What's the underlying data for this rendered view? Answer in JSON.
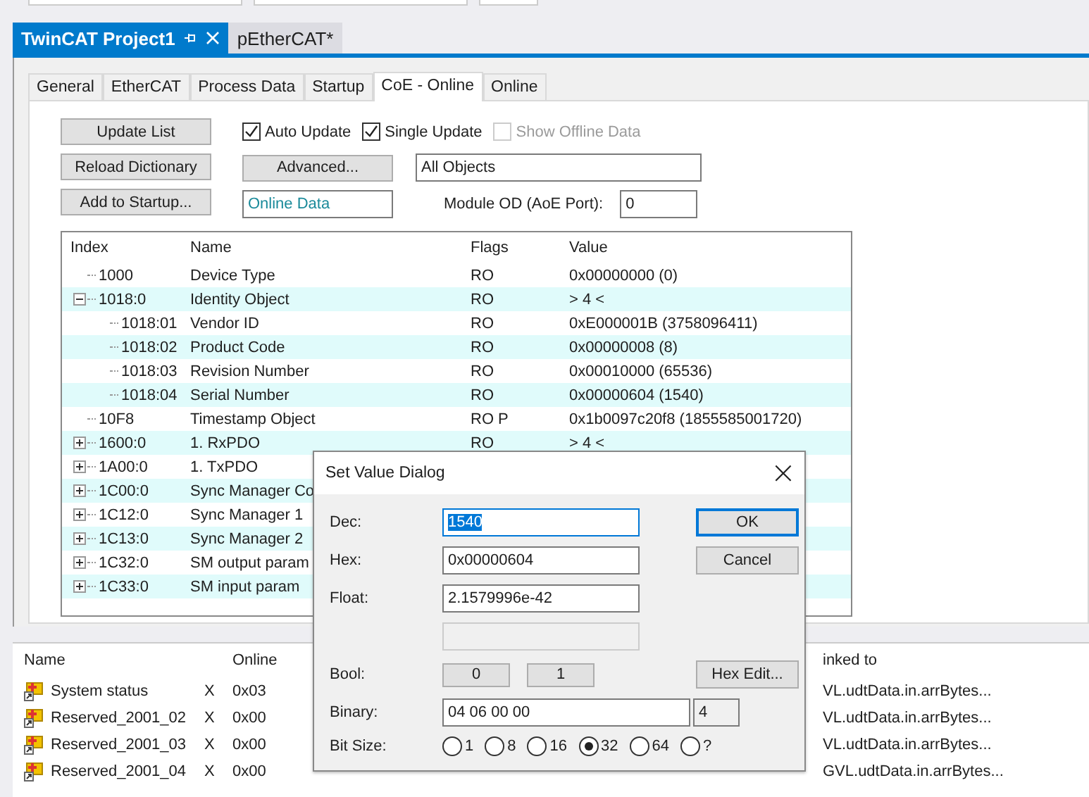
{
  "doc_tabs": [
    {
      "label": "TwinCAT Project1",
      "selected": true
    },
    {
      "label": "pEtherCAT*",
      "selected": false
    }
  ],
  "tabs": [
    {
      "label": "General",
      "selected": false
    },
    {
      "label": "EtherCAT",
      "selected": false
    },
    {
      "label": "Process Data",
      "selected": false
    },
    {
      "label": "Startup",
      "selected": false
    },
    {
      "label": "CoE - Online",
      "selected": true
    },
    {
      "label": "Online",
      "selected": false
    }
  ],
  "buttons": {
    "update_list": "Update List",
    "reload_dictionary": "Reload Dictionary",
    "add_to_startup": "Add to Startup...",
    "advanced": "Advanced..."
  },
  "checkboxes": [
    {
      "label": "Auto Update",
      "checked": true,
      "disabled": false
    },
    {
      "label": "Single Update",
      "checked": true,
      "disabled": false
    },
    {
      "label": "Show Offline Data",
      "checked": false,
      "disabled": true
    }
  ],
  "filter_field": {
    "value": "All Objects"
  },
  "data_field": {
    "value": "Online Data"
  },
  "module_od": {
    "label": "Module OD (AoE Port):",
    "value": "0"
  },
  "tree": {
    "columns": [
      "Index",
      "Name",
      "Flags",
      "Value"
    ],
    "rows": [
      {
        "index": "1000",
        "name": "Device Type",
        "flags": "RO",
        "value": "0x00000000 (0)"
      },
      {
        "index": "1018:0",
        "name": "Identity Object",
        "flags": "RO",
        "value": "> 4 <",
        "expanded": true,
        "children": [
          {
            "index": "1018:01",
            "name": "Vendor ID",
            "flags": "RO",
            "value": "0xE000001B (3758096411)"
          },
          {
            "index": "1018:02",
            "name": "Product Code",
            "flags": "RO",
            "value": "0x00000008 (8)"
          },
          {
            "index": "1018:03",
            "name": "Revision Number",
            "flags": "RO",
            "value": "0x00010000 (65536)"
          },
          {
            "index": "1018:04",
            "name": "Serial Number",
            "flags": "RO",
            "value": "0x00000604 (1540)"
          }
        ]
      },
      {
        "index": "10F8",
        "name": "Timestamp Object",
        "flags": "RO P",
        "value": "0x1b0097c20f8 (1855585001720)"
      },
      {
        "index": "1600:0",
        "name": "1. RxPDO",
        "flags": "RO",
        "value": "> 4 <",
        "expanded": false
      },
      {
        "index": "1A00:0",
        "name": "1. TxPDO",
        "expanded": false
      },
      {
        "index": "1C00:0",
        "name": "Sync Manager Co",
        "expanded": false
      },
      {
        "index": "1C12:0",
        "name": "Sync Manager 1",
        "expanded": false
      },
      {
        "index": "1C13:0",
        "name": "Sync Manager 2",
        "expanded": false
      },
      {
        "index": "1C32:0",
        "name": "SM output param",
        "expanded": false
      },
      {
        "index": "1C33:0",
        "name": "SM input param",
        "expanded": false
      }
    ]
  },
  "variables": {
    "columns": [
      "Name",
      "Online",
      "inked to"
    ],
    "rows": [
      {
        "name": "System status",
        "mark": "X",
        "online": "0x03",
        "linked_to": "VL.udtData.in.arrBytes..."
      },
      {
        "name": "Reserved_2001_02",
        "mark": "X",
        "online": "0x00",
        "linked_to": "VL.udtData.in.arrBytes..."
      },
      {
        "name": "Reserved_2001_03",
        "mark": "X",
        "online": "0x00",
        "linked_to": "VL.udtData.in.arrBytes..."
      },
      {
        "name": "Reserved_2001_04",
        "mark": "X",
        "online": "0x00",
        "linked_to": "GVL.udtData.in.arrBytes..."
      }
    ]
  },
  "dialog": {
    "title": "Set Value Dialog",
    "close": "×",
    "fields": [
      {
        "label": "Dec:",
        "value": "1540",
        "selected": true
      },
      {
        "label": "Hex:",
        "value": "0x00000604",
        "selected": false
      },
      {
        "label": "Float:",
        "value": "2.1579996e-42",
        "selected": false
      }
    ],
    "ok": "OK",
    "cancel": "Cancel",
    "bool_label": "Bool:",
    "bool_buttons": [
      "0",
      "1"
    ],
    "hex_edit": "Hex Edit...",
    "binary_label": "Binary:",
    "binary_value": "04 06 00 00",
    "byte_count": "4",
    "bit_size_label": "Bit Size:",
    "bit_sizes": [
      {
        "label": "1",
        "selected": false
      },
      {
        "label": "8",
        "selected": false
      },
      {
        "label": "16",
        "selected": false
      },
      {
        "label": "32",
        "selected": true
      },
      {
        "label": "64",
        "selected": false
      },
      {
        "label": "?",
        "selected": false
      }
    ]
  }
}
